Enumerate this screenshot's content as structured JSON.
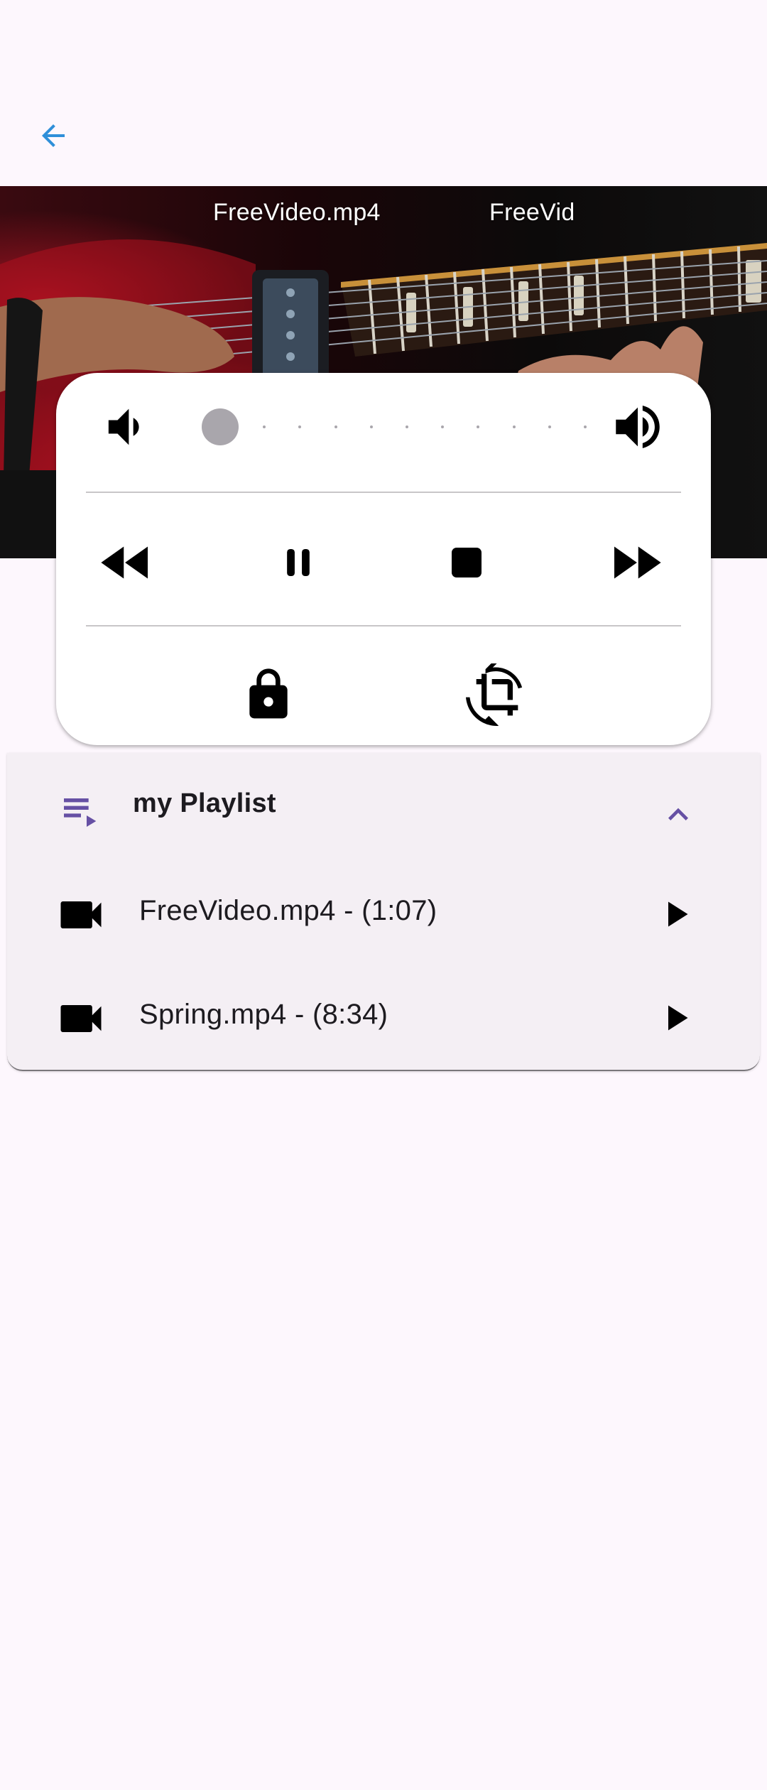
{
  "appbar": {
    "back_icon": "arrow-back-icon",
    "accent": "#2f8fd9"
  },
  "video": {
    "title_primary": "FreeVideo.mp4",
    "title_secondary": "FreeVid"
  },
  "controls": {
    "volume": {
      "value": 0.0,
      "min_icon": "volume-low-icon",
      "max_icon": "volume-high-icon",
      "steps": 11
    },
    "transport": [
      "rewind-icon",
      "pause-icon",
      "stop-icon",
      "fast-forward-icon"
    ],
    "extras": [
      "lock-icon",
      "crop-rotate-icon"
    ]
  },
  "playlist": {
    "title": "my Playlist",
    "icon": "playlist-play-icon",
    "expanded": true,
    "accent": "#6650a4",
    "items": [
      {
        "label": "FreeVideo.mp4 - (1:07)",
        "icon": "videocam-icon",
        "action_icon": "play-icon"
      },
      {
        "label": "Spring.mp4 - (8:34)",
        "icon": "videocam-icon",
        "action_icon": "play-icon"
      }
    ]
  }
}
